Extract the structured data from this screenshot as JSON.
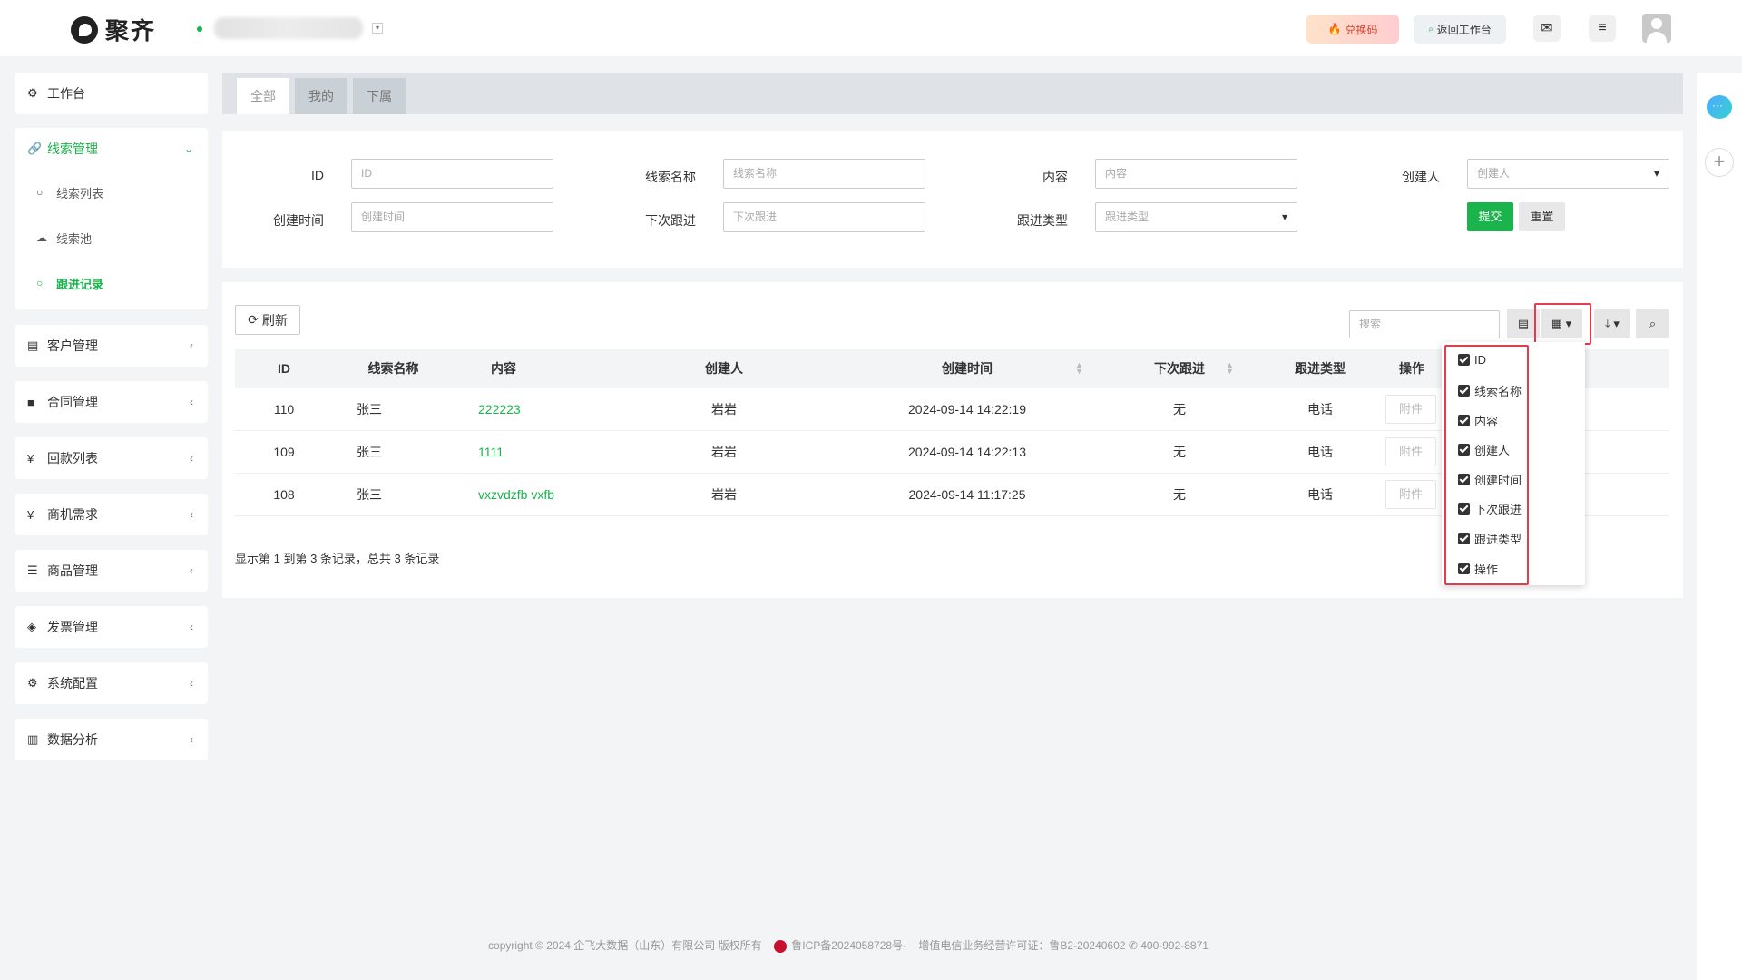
{
  "app": {
    "name": "聚齐"
  },
  "header": {
    "redeem_label": "兑换码",
    "back_label": "返回工作台"
  },
  "sidebar": {
    "workbench": "工作台",
    "lead_mgmt": "线索管理",
    "lead_list": "线索列表",
    "lead_pool": "线索池",
    "follow_records": "跟进记录",
    "customer_mgmt": "客户管理",
    "contract_mgmt": "合同管理",
    "payment_list": "回款列表",
    "opportunity": "商机需求",
    "product_mgmt": "商品管理",
    "invoice_mgmt": "发票管理",
    "system_config": "系统配置",
    "data_analysis": "数据分析"
  },
  "tabs": {
    "all": "全部",
    "mine": "我的",
    "sub": "下属"
  },
  "filters": {
    "id": {
      "label": "ID",
      "placeholder": "ID"
    },
    "lead_name": {
      "label": "线索名称",
      "placeholder": "线索名称"
    },
    "content": {
      "label": "内容",
      "placeholder": "内容"
    },
    "creator": {
      "label": "创建人",
      "placeholder": "创建人"
    },
    "created_at": {
      "label": "创建时间",
      "placeholder": "创建时间"
    },
    "next_follow": {
      "label": "下次跟进",
      "placeholder": "下次跟进"
    },
    "follow_type": {
      "label": "跟进类型",
      "placeholder": "跟进类型"
    },
    "submit": "提交",
    "reset": "重置"
  },
  "toolbar": {
    "refresh": "刷新",
    "search_placeholder": "搜索"
  },
  "table": {
    "headers": {
      "id": "ID",
      "lead_name": "线索名称",
      "content": "内容",
      "creator": "创建人",
      "created_at": "创建时间",
      "next_follow": "下次跟进",
      "follow_type": "跟进类型",
      "ops": "操作"
    },
    "rows": [
      {
        "id": "110",
        "lead_name": "张三",
        "content": "222223",
        "creator": "岩岩",
        "created_at": "2024-09-14 14:22:19",
        "next_follow": "无",
        "follow_type": "电话",
        "attach": "附件"
      },
      {
        "id": "109",
        "lead_name": "张三",
        "content": "1111",
        "creator": "岩岩",
        "created_at": "2024-09-14 14:22:13",
        "next_follow": "无",
        "follow_type": "电话",
        "attach": "附件"
      },
      {
        "id": "108",
        "lead_name": "张三",
        "content": "vxzvdzfb vxfb",
        "creator": "岩岩",
        "created_at": "2024-09-14 11:17:25",
        "next_follow": "无",
        "follow_type": "电话",
        "attach": "附件"
      }
    ],
    "pager_text": "显示第 1 到第 3 条记录，总共 3 条记录"
  },
  "column_menu": {
    "options": [
      "ID",
      "线索名称",
      "内容",
      "创建人",
      "创建时间",
      "下次跟进",
      "跟进类型",
      "操作"
    ]
  },
  "footer": {
    "copyright": "copyright © 2024 企飞大数据（山东）有限公司 版权所有",
    "icp": "鲁ICP备2024058728号-",
    "license": "增值电信业务经营许可证：鲁B2-20240602",
    "phone": "400-992-8871"
  },
  "colors": {
    "accent": "#1ab34c",
    "highlight": "#e43b4d"
  }
}
